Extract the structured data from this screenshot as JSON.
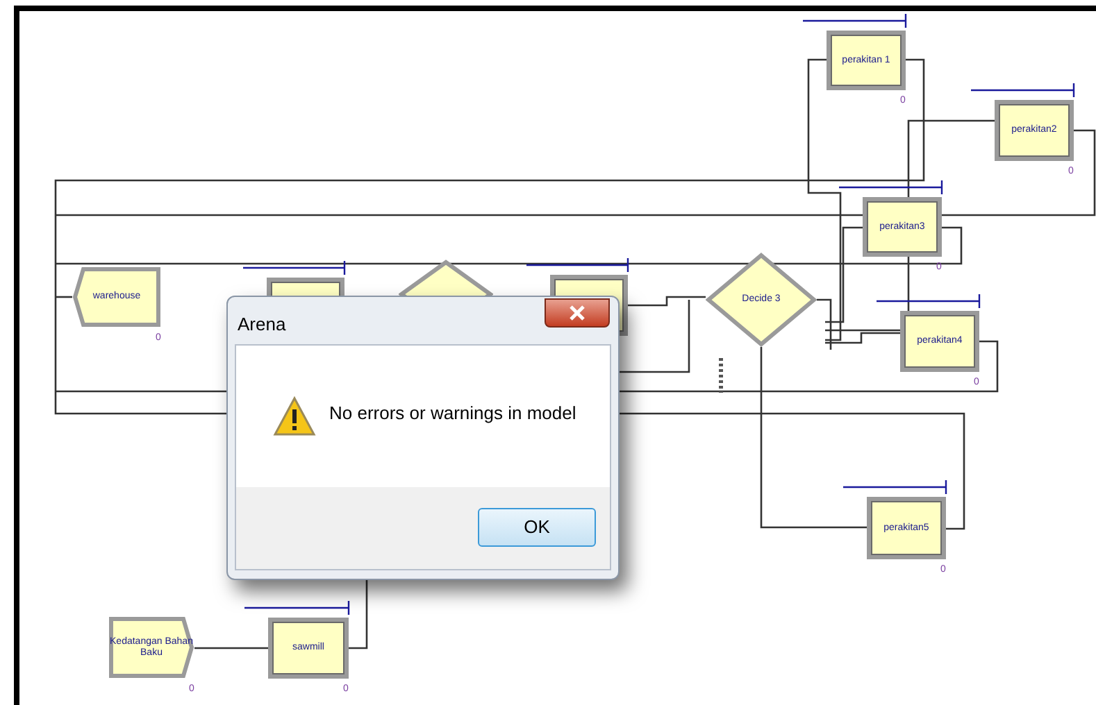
{
  "model": {
    "modules": [
      {
        "kind": "dispose",
        "label": "warehouse",
        "counter": "0"
      },
      {
        "kind": "process"
      },
      {
        "kind": "decide"
      },
      {
        "kind": "process"
      },
      {
        "kind": "decide",
        "label": "Decide 3"
      },
      {
        "kind": "process",
        "label": "perakitan 1",
        "counter": "0"
      },
      {
        "kind": "process",
        "label": "perakitan2",
        "counter": "0"
      },
      {
        "kind": "process",
        "label": "perakitan3",
        "counter": "0"
      },
      {
        "kind": "process",
        "label": "perakitan4",
        "counter": "0"
      },
      {
        "kind": "process",
        "label": "perakitan5",
        "counter": "0"
      },
      {
        "kind": "create",
        "label": "Kedatangan Bahan Baku",
        "counter": "0"
      },
      {
        "kind": "process",
        "label": "sawmill",
        "counter": "0"
      }
    ]
  },
  "dialog": {
    "title": "Arena",
    "message": "No errors or warnings in model",
    "button": "OK"
  }
}
